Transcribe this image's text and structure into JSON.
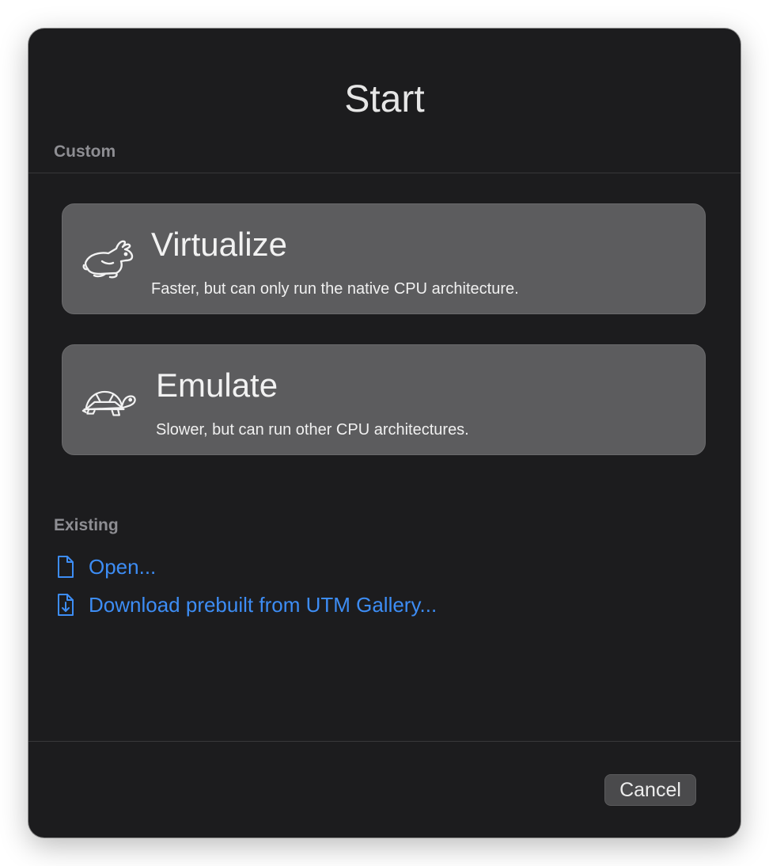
{
  "dialog": {
    "title": "Start"
  },
  "custom": {
    "section_label": "Custom",
    "options": [
      {
        "title": "Virtualize",
        "subtitle": "Faster, but can only run the native CPU architecture.",
        "icon": "rabbit-icon"
      },
      {
        "title": "Emulate",
        "subtitle": "Slower, but can run other CPU architectures.",
        "icon": "turtle-icon"
      }
    ]
  },
  "existing": {
    "section_label": "Existing",
    "links": [
      {
        "label": "Open...",
        "icon": "document-icon"
      },
      {
        "label": "Download prebuilt from UTM Gallery...",
        "icon": "document-download-icon"
      }
    ]
  },
  "footer": {
    "cancel_label": "Cancel"
  },
  "colors": {
    "window_background": "#1c1c1e",
    "card_background": "#5c5c5e",
    "link_accent": "#3d8df5",
    "section_label": "#8e8e93"
  }
}
